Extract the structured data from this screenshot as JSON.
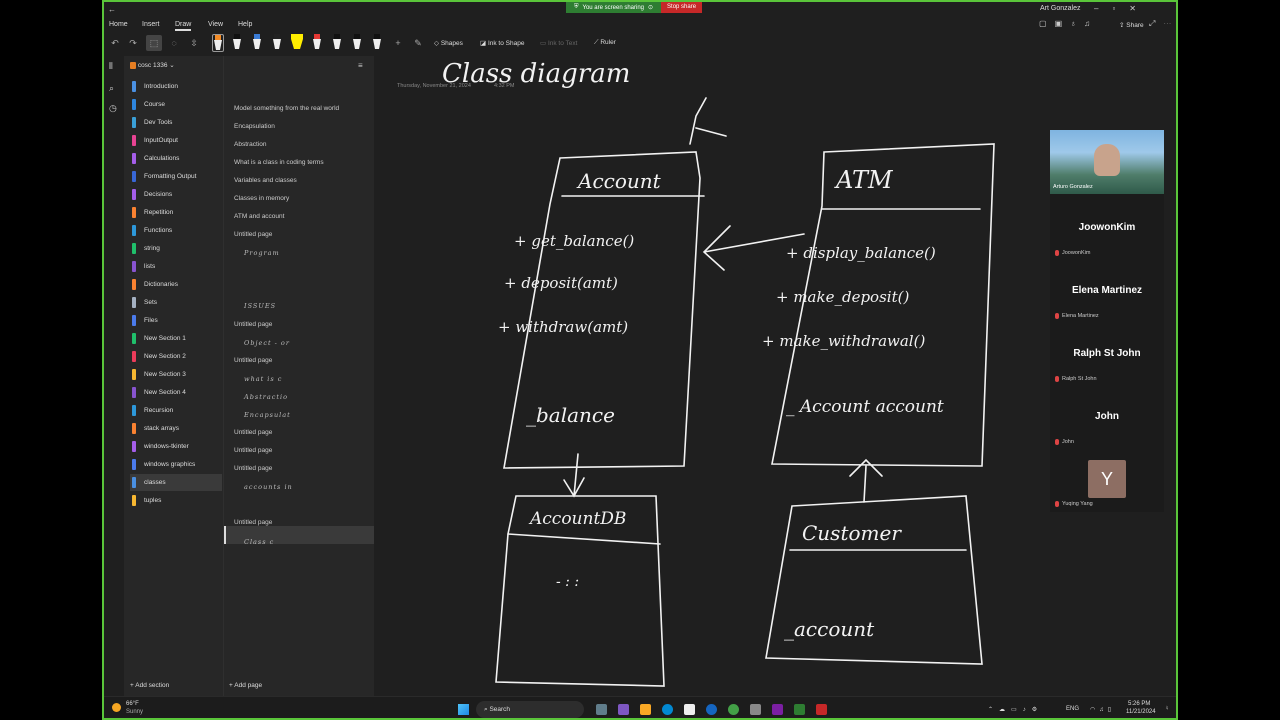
{
  "share_bar": {
    "sharing_text": "You are screen sharing",
    "stop_label": "Stop share"
  },
  "user": {
    "name": "Art Gonzalez"
  },
  "menu": {
    "items": [
      "Home",
      "Insert",
      "Draw",
      "View",
      "Help"
    ],
    "active": "Draw"
  },
  "toolbar": {
    "shapes_label": "Shapes",
    "ink_to_shape_label": "Ink to Shape",
    "ink_to_text_label": "Ink to Text",
    "ruler_label": "Ruler",
    "share_label": "Share"
  },
  "notebook": {
    "name": "cosc 1336"
  },
  "sections": [
    {
      "label": "Introduction",
      "color": "#4a90e2"
    },
    {
      "label": "Course",
      "color": "#2e86de"
    },
    {
      "label": "Dev Tools",
      "color": "#3aa0d8"
    },
    {
      "label": "InputOutput",
      "color": "#e84393"
    },
    {
      "label": "Calculations",
      "color": "#a55eea"
    },
    {
      "label": "Formatting Output",
      "color": "#3867d6"
    },
    {
      "label": "Decisions",
      "color": "#a55eea"
    },
    {
      "label": "Repetition",
      "color": "#fa8231"
    },
    {
      "label": "Functions",
      "color": "#2d98da"
    },
    {
      "label": "string",
      "color": "#20bf6b"
    },
    {
      "label": "lists",
      "color": "#8854d0"
    },
    {
      "label": "Dictionaries",
      "color": "#fa8231"
    },
    {
      "label": "Sets",
      "color": "#a5b1c2"
    },
    {
      "label": "Files",
      "color": "#4b7bec"
    },
    {
      "label": "New Section 1",
      "color": "#20bf6b"
    },
    {
      "label": "New Section 2",
      "color": "#eb3b5a"
    },
    {
      "label": "New Section 3",
      "color": "#f7b731"
    },
    {
      "label": "New Section 4",
      "color": "#8854d0"
    },
    {
      "label": "Recursion",
      "color": "#2d98da"
    },
    {
      "label": "stack arrays",
      "color": "#fa8231"
    },
    {
      "label": "windows-tkinter",
      "color": "#a55eea"
    },
    {
      "label": "windows graphics",
      "color": "#4b7bec"
    },
    {
      "label": "classes",
      "color": "#4a90e2"
    },
    {
      "label": "tuples",
      "color": "#f7b731"
    }
  ],
  "selected_section": "classes",
  "pages": [
    {
      "label": "Model something from the real world",
      "hw": false
    },
    {
      "label": "Encapsulation",
      "hw": false
    },
    {
      "label": "Abstraction",
      "hw": false
    },
    {
      "label": "What is a class in coding terms",
      "hw": false
    },
    {
      "label": "Variables and classes",
      "hw": false
    },
    {
      "label": "Classes in memory",
      "hw": false
    },
    {
      "label": "ATM and account",
      "hw": false
    },
    {
      "label": "Untitled page",
      "hw": false
    },
    {
      "label": "Program",
      "hw": true
    },
    {
      "label": "ISSUES",
      "hw": true
    },
    {
      "label": "Untitled page",
      "hw": false
    },
    {
      "label": "Object - or",
      "hw": true
    },
    {
      "label": "Untitled page",
      "hw": false
    },
    {
      "label": "what is c",
      "hw": true
    },
    {
      "label": "Abstractio",
      "hw": true
    },
    {
      "label": "Encapsulat",
      "hw": true
    },
    {
      "label": "Untitled page",
      "hw": false
    },
    {
      "label": "Untitled page",
      "hw": false
    },
    {
      "label": "Untitled page",
      "hw": false
    },
    {
      "label": "accounts in",
      "hw": true
    },
    {
      "label": "Untitled page",
      "hw": false
    },
    {
      "label": "Class c",
      "hw": true
    }
  ],
  "footer": {
    "add_section": "Add section",
    "add_page": "Add page"
  },
  "note": {
    "date": "Thursday, November 21, 2024",
    "time": "4:32 PM",
    "title": "Class diagram",
    "account": {
      "name": "Account",
      "methods": [
        "+ get_balance()",
        "+ deposit(amt)",
        "+ withdraw(amt)"
      ],
      "attribute": "_balance"
    },
    "atm": {
      "name": "ATM",
      "methods": [
        "+ display_balance()",
        "+ make_deposit()",
        "+ make_withdrawal()"
      ],
      "attribute": "_ Account account"
    },
    "accountdb": {
      "name": "AccountDB",
      "dots": "- : :"
    },
    "customer": {
      "name": "Customer",
      "attribute": "_account"
    }
  },
  "participants": [
    {
      "name": "Arturo Gonzalez",
      "video": true
    },
    {
      "display": "JoowonKim",
      "small": "JoowonKim"
    },
    {
      "display": "Elena Martinez",
      "small": "Elena Martinez"
    },
    {
      "display": "Ralph St John",
      "small": "Ralph St John"
    },
    {
      "display": "John",
      "small": "John"
    },
    {
      "avatar_letter": "Y",
      "small": "Yuqing Yang"
    }
  ],
  "taskbar": {
    "weather_temp": "66°F",
    "weather_text": "Sunny",
    "search_label": "Search",
    "language": "ENG",
    "time": "5:26 PM",
    "date": "11/21/2024"
  }
}
